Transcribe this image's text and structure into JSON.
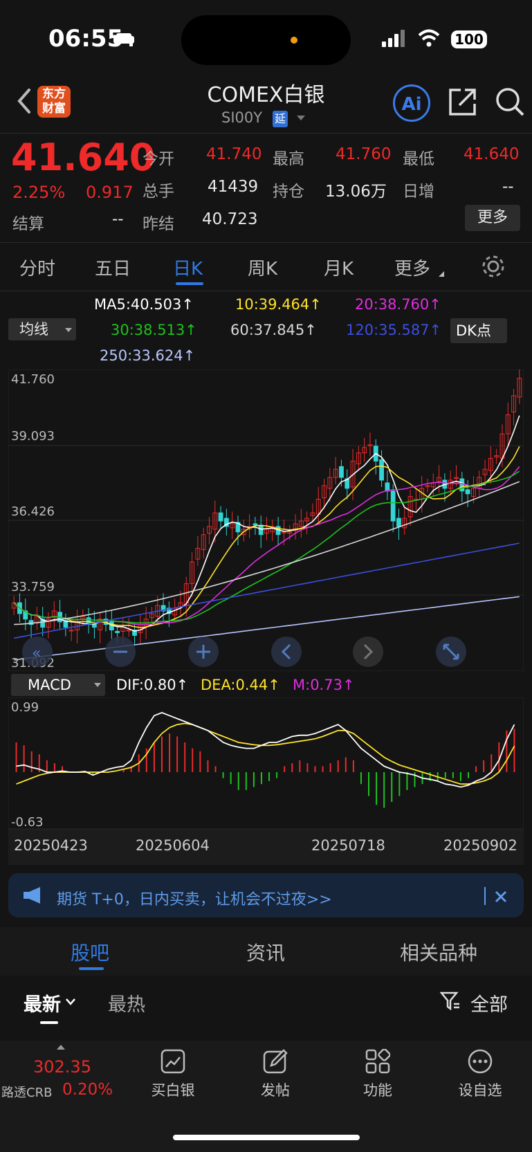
{
  "status": {
    "time": "06:55",
    "battery": "100"
  },
  "header": {
    "logo": "东方财富",
    "title": "COMEX白银",
    "code": "SI00Y",
    "delay_badge": "延"
  },
  "quote": {
    "price": "41.640",
    "change_pct": "2.25%",
    "change": "0.917",
    "open_label": "今开",
    "open": "41.740",
    "high_label": "最高",
    "high": "41.760",
    "low_label": "最低",
    "low": "41.640",
    "volume_label": "总手",
    "volume": "41439",
    "oi_label": "持仓",
    "oi": "13.06万",
    "daily_inc_label": "日增",
    "daily_inc": "--",
    "settle_label": "结算",
    "settle": "--",
    "prev_settle_label": "昨结",
    "prev_settle": "40.723",
    "more_button": "更多"
  },
  "tabs": [
    {
      "label": "分时"
    },
    {
      "label": "五日"
    },
    {
      "label": "日K"
    },
    {
      "label": "周K"
    },
    {
      "label": "月K"
    },
    {
      "label": "更多"
    }
  ],
  "ma": {
    "selector": "均线",
    "ma5": "MA5:40.503↑",
    "ma10": "10:39.464↑",
    "ma20": "20:38.760↑",
    "ma30": "30:38.513↑",
    "ma60": "60:37.845↑",
    "ma120": "120:35.587↑",
    "ma250": "250:33.624↑",
    "dk_button": "DK点",
    "colors": {
      "ma5": "#ffffff",
      "ma10": "#ffe32a",
      "ma20": "#e02de0",
      "ma30": "#1ec21e",
      "ma60": "#d8d8d8",
      "ma120": "#3d4fe0",
      "ma250": "#b7c6ff"
    }
  },
  "price_axis": {
    "top": "41.760",
    "l2": "39.093",
    "l3": "36.426",
    "l4": "33.759",
    "bottom": "31.092"
  },
  "macd": {
    "selector": "MACD",
    "dif": "DIF:0.80↑",
    "dea": "DEA:0.44↑",
    "m": "M:0.73↑",
    "top": "0.99",
    "bottom": "-0.63"
  },
  "dates": [
    "20250423",
    "20250604",
    "20250718",
    "20250902"
  ],
  "banner": {
    "text": "期货 T+0，日内买卖，让机会不过夜>>"
  },
  "sub_tabs": [
    {
      "label": "股吧"
    },
    {
      "label": "资讯"
    },
    {
      "label": "相关品种"
    }
  ],
  "filter_tabs": {
    "latest": "最新",
    "hot": "最热",
    "all": "全部"
  },
  "bottom_bar": {
    "index_value": "302.35",
    "index_name": "路透CRB",
    "index_change": "0.20%",
    "buy": "买白银",
    "post": "发帖",
    "func": "功能",
    "watch": "设自选"
  },
  "chart_data": {
    "type": "candlestick",
    "ylim": [
      31.092,
      41.76
    ],
    "x": [
      "20250423",
      "20250604",
      "20250718",
      "20250902"
    ],
    "close_approx": [
      33.4,
      33.0,
      32.8,
      32.6,
      32.9,
      32.5,
      32.8,
      33.1,
      32.7,
      32.5,
      32.4,
      32.7,
      32.9,
      32.6,
      32.5,
      32.8,
      32.6,
      32.4,
      32.3,
      32.5,
      32.4,
      32.2,
      32.6,
      32.8,
      33.0,
      33.3,
      33.1,
      33.0,
      33.2,
      33.4,
      34.1,
      34.9,
      35.4,
      35.9,
      36.2,
      36.7,
      36.4,
      36.2,
      36.3,
      36.0,
      36.1,
      36.2,
      36.3,
      35.9,
      36.1,
      36.2,
      35.9,
      36.0,
      36.0,
      36.3,
      36.4,
      36.5,
      36.7,
      37.2,
      37.7,
      38.0,
      38.3,
      38.0,
      37.6,
      38.6,
      38.9,
      39.1,
      39.2,
      38.6,
      37.9,
      37.5,
      36.4,
      36.2,
      36.5,
      37.3,
      37.2,
      37.6,
      37.7,
      37.8,
      38.0,
      37.6,
      37.9,
      38.0,
      37.5,
      37.4,
      37.6,
      38.0,
      38.3,
      38.7,
      38.8,
      39.6,
      40.3,
      41.0,
      41.64
    ],
    "macd_hist_approx": [
      0.5,
      0.45,
      0.35,
      0.3,
      0.2,
      0.15,
      0.1,
      0.0,
      0.0,
      0.0,
      -0.05,
      0.0,
      0.0,
      0.0,
      0.05,
      0.1,
      0.3,
      0.4,
      0.5,
      0.6,
      0.65,
      0.6,
      0.5,
      0.4,
      0.35,
      0.2,
      0.1,
      -0.1,
      -0.2,
      -0.3,
      -0.3,
      -0.25,
      -0.2,
      -0.15,
      -0.1,
      0.1,
      0.15,
      0.2,
      0.15,
      0.1,
      0.1,
      0.15,
      0.2,
      0.25,
      0.2,
      -0.2,
      -0.4,
      -0.55,
      -0.6,
      -0.5,
      -0.4,
      -0.3,
      -0.25,
      -0.2,
      -0.15,
      -0.15,
      -0.1,
      -0.1,
      -0.15,
      -0.1,
      0.1,
      0.2,
      0.3,
      0.5,
      0.7,
      0.73
    ]
  }
}
